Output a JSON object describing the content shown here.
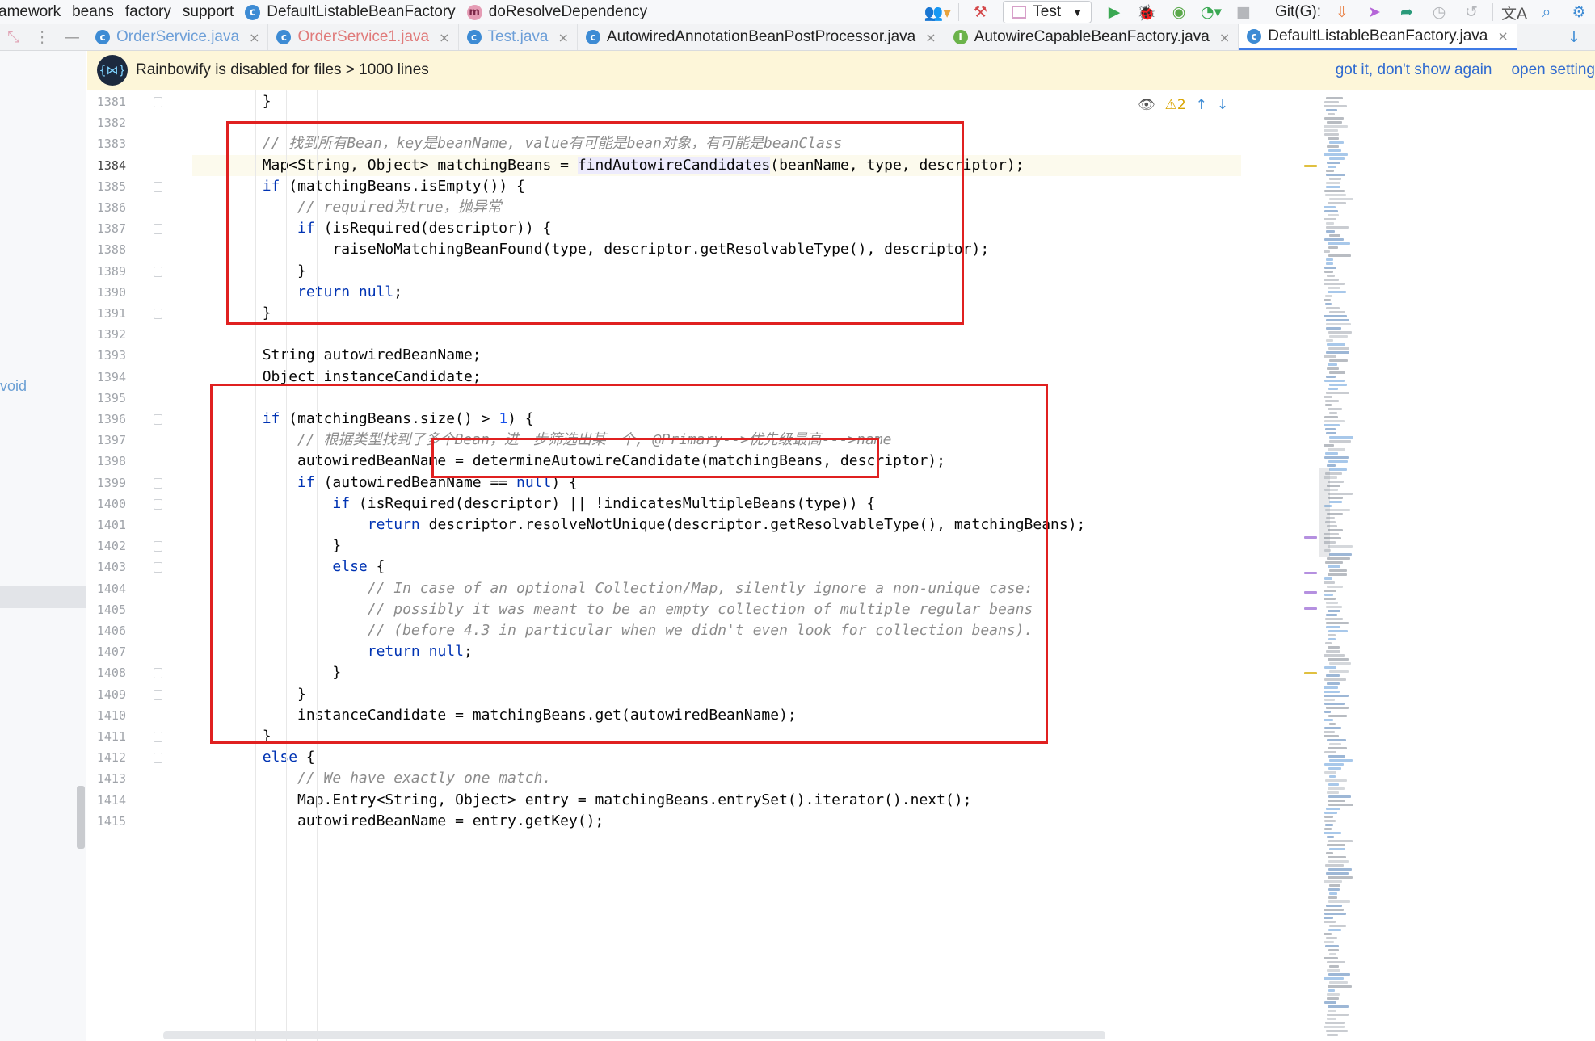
{
  "navbar": {
    "breadcrumbs": [
      {
        "label": "amework",
        "icon": ""
      },
      {
        "label": "beans",
        "icon": ""
      },
      {
        "label": "factory",
        "icon": ""
      },
      {
        "label": "support",
        "icon": ""
      },
      {
        "label": "DefaultListableBeanFactory",
        "icon": "class-icon",
        "glyph": "c"
      },
      {
        "label": "doResolveDependency",
        "icon": "method-icon",
        "glyph": "m"
      }
    ],
    "run_config": "Test",
    "git_label": "Git(G):"
  },
  "tabs": [
    {
      "label": "OrderService.java",
      "glyph": "c",
      "state": "dim"
    },
    {
      "label": "OrderService1.java",
      "glyph": "c",
      "state": "modified"
    },
    {
      "label": "Test.java",
      "glyph": "c",
      "state": "dim"
    },
    {
      "label": "AutowiredAnnotationBeanPostProcessor.java",
      "glyph": "c",
      "state": "normal"
    },
    {
      "label": "AutowireCapableBeanFactory.java",
      "glyph": "I",
      "state": "normal"
    },
    {
      "label": "DefaultListableBeanFactory.java",
      "glyph": "c",
      "state": "active"
    }
  ],
  "notice": {
    "message": "Rainbowify is disabled for files > 1000 lines",
    "action_dismiss": "got it, don't show again",
    "action_settings": "open setting"
  },
  "left_strip": {
    "fragment": "void"
  },
  "inspection": {
    "warnings": "2"
  },
  "editor": {
    "current_line": 1384,
    "lines": [
      {
        "n": 1381,
        "html": "        }"
      },
      {
        "n": 1382,
        "html": ""
      },
      {
        "n": 1383,
        "html": "        <span class=\"cmt\">// 找到所有Bean，key是beanName, value有可能是bean对象，有可能是beanClass</span>"
      },
      {
        "n": 1384,
        "html": "        Map&lt;String, Object&gt; matchingBeans = <span class=\"fn-hl\">findAutowireCandidates</span>(beanName, type, descriptor);"
      },
      {
        "n": 1385,
        "html": "        <span class=\"kw\">if</span> (matchingBeans.isEmpty()) {"
      },
      {
        "n": 1386,
        "html": "            <span class=\"cmt\">// required为true，抛异常</span>"
      },
      {
        "n": 1387,
        "html": "            <span class=\"kw\">if</span> (isRequired(descriptor)) {"
      },
      {
        "n": 1388,
        "html": "                raiseNoMatchingBeanFound(type, descriptor.getResolvableType(), descriptor);"
      },
      {
        "n": 1389,
        "html": "            }"
      },
      {
        "n": 1390,
        "html": "            <span class=\"kw\">return null</span>;"
      },
      {
        "n": 1391,
        "html": "        }"
      },
      {
        "n": 1392,
        "html": ""
      },
      {
        "n": 1393,
        "html": "        String autowiredBeanName;"
      },
      {
        "n": 1394,
        "html": "        Object instanceCandidate;"
      },
      {
        "n": 1395,
        "html": ""
      },
      {
        "n": 1396,
        "html": "        <span class=\"kw\">if</span> (matchingBeans.size() &gt; <span class=\"num\">1</span>) {"
      },
      {
        "n": 1397,
        "html": "            <span class=\"cmt\">// 根据类型找到了多个Bean，进一步筛选出某一个, @Primary--&gt;优先级最高---&gt;name</span>"
      },
      {
        "n": 1398,
        "html": "            autowiredBeanName = determineAutowireCandidate(matchingBeans, descriptor);"
      },
      {
        "n": 1399,
        "html": "            <span class=\"kw\">if</span> (autowiredBeanName == <span class=\"kw\">null</span>) {"
      },
      {
        "n": 1400,
        "html": "                <span class=\"kw\">if</span> (isRequired(descriptor) || !indicatesMultipleBeans(type)) {"
      },
      {
        "n": 1401,
        "html": "                    <span class=\"kw\">return</span> descriptor.resolveNotUnique(descriptor.getResolvableType(), matchingBeans);"
      },
      {
        "n": 1402,
        "html": "                }"
      },
      {
        "n": 1403,
        "html": "                <span class=\"kw\">else</span> {"
      },
      {
        "n": 1404,
        "html": "                    <span class=\"cmt\">// In case of an optional Collection/Map, silently ignore a non-unique case:</span>"
      },
      {
        "n": 1405,
        "html": "                    <span class=\"cmt\">// possibly it was meant to be an empty collection of multiple regular beans</span>"
      },
      {
        "n": 1406,
        "html": "                    <span class=\"cmt\">// (before 4.3 in particular when we didn't even look for collection beans).</span>"
      },
      {
        "n": 1407,
        "html": "                    <span class=\"kw\">return null</span>;"
      },
      {
        "n": 1408,
        "html": "                }"
      },
      {
        "n": 1409,
        "html": "            }"
      },
      {
        "n": 1410,
        "html": "            instanceCandidate = matchingBeans.get(autowiredBeanName);"
      },
      {
        "n": 1411,
        "html": "        }"
      },
      {
        "n": 1412,
        "html": "        <span class=\"kw\">else</span> {"
      },
      {
        "n": 1413,
        "html": "            <span class=\"cmt\">// We have exactly one match.</span>"
      },
      {
        "n": 1414,
        "html": "            Map.Entry&lt;String, Object&gt; entry = matchingBeans.entrySet().iterator().next();"
      },
      {
        "n": 1415,
        "html": "            autowiredBeanName = entry.getKey();"
      }
    ]
  },
  "colors": {
    "keyword": "#0033b3",
    "comment": "#8c8c8c",
    "annotation_box": "#e02020",
    "active_tab": "#3f7be6",
    "notice_bg": "#fdf6d9"
  }
}
